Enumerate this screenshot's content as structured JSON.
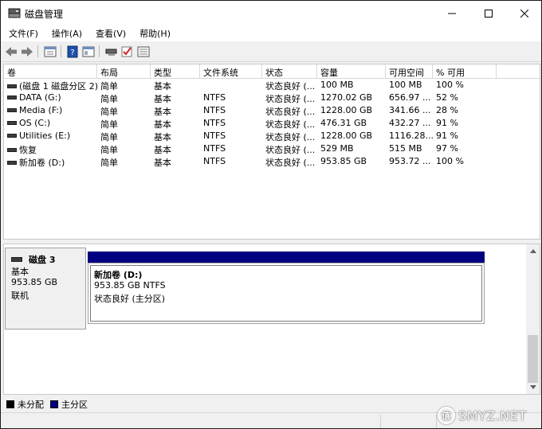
{
  "window": {
    "title": "磁盘管理"
  },
  "menu": [
    "文件(F)",
    "操作(A)",
    "查看(V)",
    "帮助(H)"
  ],
  "toolbar": {
    "icons": [
      "back-icon",
      "forward-icon",
      "properties-icon",
      "help-icon",
      "console-icon",
      "disk-icon",
      "check-icon",
      "list-icon"
    ]
  },
  "volumes": {
    "headers": [
      "卷",
      "布局",
      "类型",
      "文件系统",
      "状态",
      "容量",
      "可用空间",
      "% 可用"
    ],
    "rows": [
      [
        "(磁盘 1 磁盘分区 2)",
        "简单",
        "基本",
        "",
        "状态良好 (...",
        "100 MB",
        "100 MB",
        "100 %"
      ],
      [
        "DATA (G:)",
        "简单",
        "基本",
        "NTFS",
        "状态良好 (...",
        "1270.02 GB",
        "656.97 ...",
        "52 %"
      ],
      [
        "Media (F:)",
        "简单",
        "基本",
        "NTFS",
        "状态良好 (...",
        "1228.00 GB",
        "341.66 ...",
        "28 %"
      ],
      [
        "OS (C:)",
        "简单",
        "基本",
        "NTFS",
        "状态良好 (...",
        "476.31 GB",
        "432.27 ...",
        "91 %"
      ],
      [
        "Utilities (E:)",
        "简单",
        "基本",
        "NTFS",
        "状态良好 (...",
        "1228.00 GB",
        "1116.28...",
        "91 %"
      ],
      [
        "恢复",
        "简单",
        "基本",
        "NTFS",
        "状态良好 (...",
        "529 MB",
        "515 MB",
        "97 %"
      ],
      [
        "新加卷 (D:)",
        "简单",
        "基本",
        "NTFS",
        "状态良好 (...",
        "953.85 GB",
        "953.72 ...",
        "100 %"
      ]
    ]
  },
  "disk": {
    "name": "磁盘 3",
    "type": "基本",
    "size": "953.85 GB",
    "status": "联机",
    "partition": {
      "name": "新加卷  (D:)",
      "size_fs": "953.85 GB NTFS",
      "status": "状态良好 (主分区)"
    }
  },
  "legend": [
    {
      "label": "未分配",
      "color": "#000000"
    },
    {
      "label": "主分区",
      "color": "#000080"
    }
  ],
  "watermark": {
    "text": "SMYZ.NET",
    "badge": "值"
  }
}
